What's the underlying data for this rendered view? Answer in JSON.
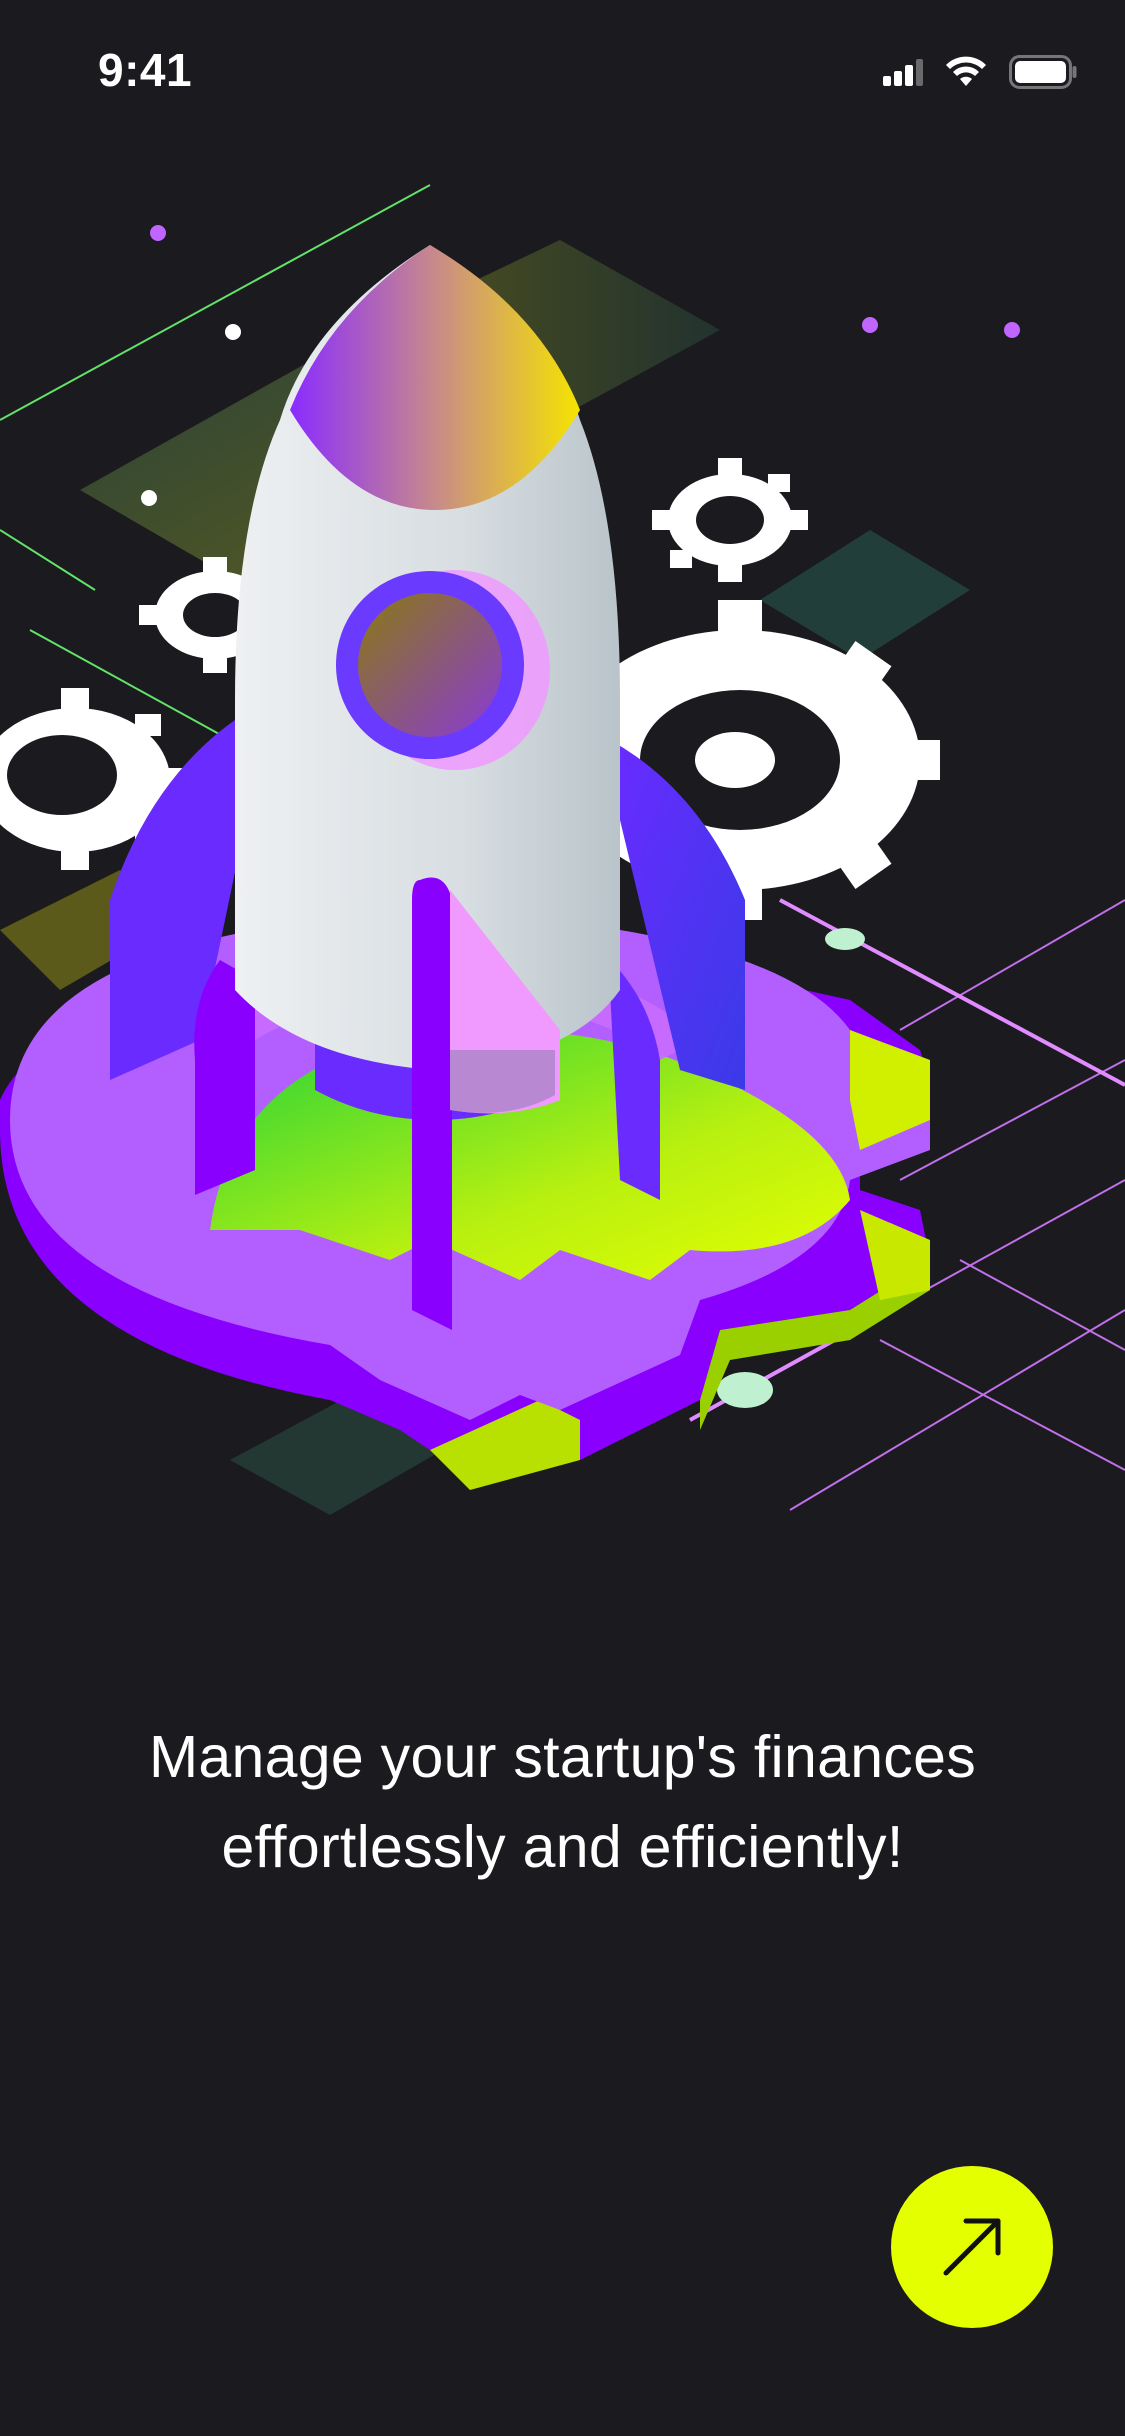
{
  "status_bar": {
    "time": "9:41",
    "icons": [
      "cellular-signal-icon",
      "wifi-icon",
      "battery-icon"
    ]
  },
  "hero": {
    "illustration": "rocket-launch-illustration",
    "elements": [
      "rocket-icon",
      "gear-icon",
      "puzzle-base"
    ]
  },
  "onboarding": {
    "headline_line1": "Manage your startup's finances",
    "headline_line2": "effortlessly and efficiently!"
  },
  "next_button": {
    "icon": "arrow-up-right-icon"
  },
  "colors": {
    "background": "#1b1a1e",
    "accent": "#e4ff00",
    "purple": "#7b2cff",
    "violet": "#b368ff",
    "lime": "#c8f000",
    "text": "#ffffff"
  }
}
